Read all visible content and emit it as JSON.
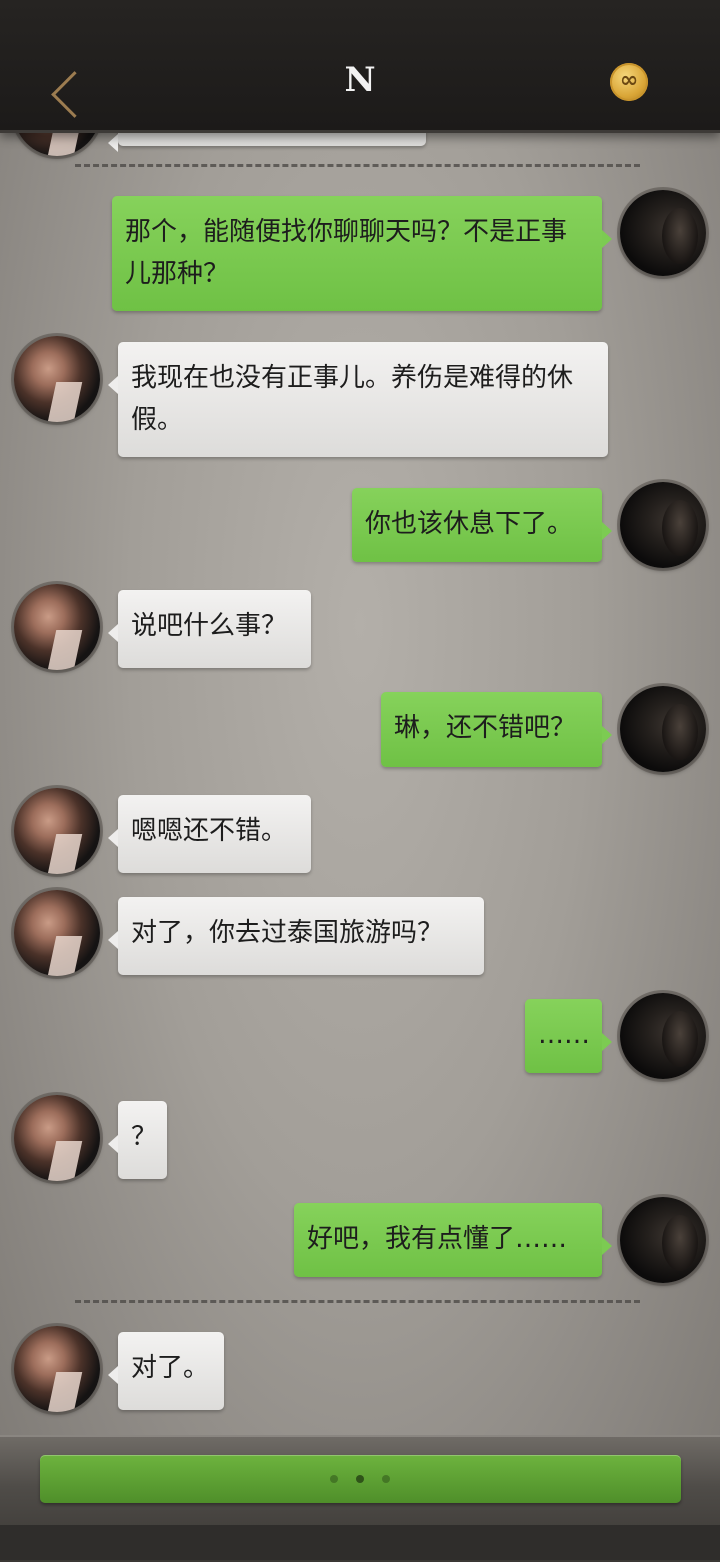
{
  "header": {
    "title": "N",
    "back_icon": "chevron-left-icon",
    "coin_symbol": "∞"
  },
  "messages": [
    {
      "side": "right",
      "text": "那个，能随便找你聊聊天吗？不是正事儿那种？"
    },
    {
      "side": "left",
      "text": "我现在也没有正事儿。养伤是难得的休假。"
    },
    {
      "side": "right",
      "text": "你也该休息下了。"
    },
    {
      "side": "left",
      "text": "说吧什么事？"
    },
    {
      "side": "right",
      "text": "琳，还不错吧？"
    },
    {
      "side": "left",
      "text": "嗯嗯还不错。"
    },
    {
      "side": "left",
      "text": "对了，你去过泰国旅游吗？"
    },
    {
      "side": "right",
      "text": "……"
    },
    {
      "side": "left",
      "text": "？"
    },
    {
      "side": "right",
      "text": "好吧，我有点懂了……"
    },
    {
      "side": "left",
      "text": "对了。"
    }
  ],
  "colors": {
    "accent_green": "#7ccb52",
    "header_bg": "#1c1a19",
    "back_arrow": "#9c7c50"
  },
  "pager": {
    "count": 3,
    "active_index": 1
  }
}
